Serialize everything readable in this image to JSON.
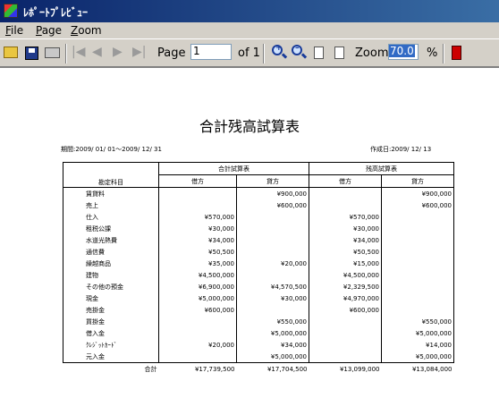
{
  "window": {
    "title": "ﾚﾎﾟｰﾄﾌﾟﾚﾋﾞｭｰ"
  },
  "menu": [
    {
      "label": "File",
      "u": "F",
      "rest": "ile"
    },
    {
      "label": "Page",
      "u": "P",
      "rest": "age"
    },
    {
      "label": "Zoom",
      "u": "Z",
      "rest": "oom"
    }
  ],
  "toolbar": {
    "page_label": "Page",
    "page_value": "1",
    "of_label": "of 1",
    "zoom_label": "Zoom",
    "zoom_value": "70.0",
    "percent": "%",
    "icons": [
      "open-folder-icon",
      "save-icon",
      "print-icon",
      "first-page-icon",
      "prev-page-icon",
      "next-page-icon",
      "last-page-icon",
      "zoom-in-icon",
      "zoom-out-icon",
      "fit-page-icon",
      "page-icon",
      "exit-icon"
    ]
  },
  "report": {
    "title": "合計残高試算表",
    "period": "期間:2009/ 01/ 01～2009/ 12/ 31",
    "created": "作成日:2009/ 12/ 13",
    "col_account": "勘定科目",
    "group_total": "合計試算表",
    "group_balance": "残高試算表",
    "debit": "借方",
    "credit": "貸方",
    "rows": [
      {
        "account": "賃貸料",
        "td": "",
        "tc": "¥900,000",
        "bd": "",
        "bc": "¥900,000"
      },
      {
        "account": "売上",
        "td": "",
        "tc": "¥600,000",
        "bd": "",
        "bc": "¥600,000"
      },
      {
        "account": "仕入",
        "td": "¥570,000",
        "tc": "",
        "bd": "¥570,000",
        "bc": ""
      },
      {
        "account": "租税公課",
        "td": "¥30,000",
        "tc": "",
        "bd": "¥30,000",
        "bc": ""
      },
      {
        "account": "水道光熱費",
        "td": "¥34,000",
        "tc": "",
        "bd": "¥34,000",
        "bc": ""
      },
      {
        "account": "通信費",
        "td": "¥50,500",
        "tc": "",
        "bd": "¥50,500",
        "bc": ""
      },
      {
        "account": "繰越商品",
        "td": "¥35,000",
        "tc": "¥20,000",
        "bd": "¥15,000",
        "bc": ""
      },
      {
        "account": "建物",
        "td": "¥4,500,000",
        "tc": "",
        "bd": "¥4,500,000",
        "bc": ""
      },
      {
        "account": "その他の預金",
        "td": "¥6,900,000",
        "tc": "¥4,570,500",
        "bd": "¥2,329,500",
        "bc": ""
      },
      {
        "account": "現金",
        "td": "¥5,000,000",
        "tc": "¥30,000",
        "bd": "¥4,970,000",
        "bc": ""
      },
      {
        "account": "売掛金",
        "td": "¥600,000",
        "tc": "",
        "bd": "¥600,000",
        "bc": ""
      },
      {
        "account": "買掛金",
        "td": "",
        "tc": "¥550,000",
        "bd": "",
        "bc": "¥550,000"
      },
      {
        "account": "借入金",
        "td": "",
        "tc": "¥5,000,000",
        "bd": "",
        "bc": "¥5,000,000"
      },
      {
        "account": "ｸﾚｼﾞｯﾄｶｰﾄﾞ",
        "td": "¥20,000",
        "tc": "¥34,000",
        "bd": "",
        "bc": "¥14,000"
      },
      {
        "account": "元入金",
        "td": "",
        "tc": "¥5,000,000",
        "bd": "",
        "bc": "¥5,000,000"
      }
    ],
    "total_label": "合計",
    "totals": {
      "td": "¥17,739,500",
      "tc": "¥17,704,500",
      "bd": "¥13,099,000",
      "bc": "¥13,084,000"
    }
  }
}
